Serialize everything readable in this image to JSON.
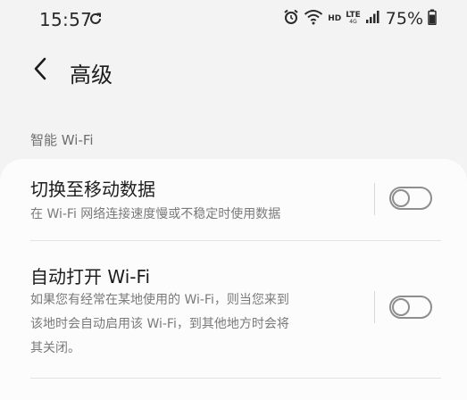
{
  "status_bar": {
    "time": "15:57",
    "hd_label": "HD",
    "lte_label": "LTE",
    "lte_sub": "4G",
    "battery_percent": "75%",
    "icons": [
      "sync-icon",
      "alarm-icon",
      "wifi-icon",
      "signal-icon",
      "battery-icon"
    ]
  },
  "header": {
    "back_icon": "chevron-left-icon",
    "title": "高级"
  },
  "section": {
    "title": "智能 Wi-Fi"
  },
  "settings": [
    {
      "title": "切换至移动数据",
      "subtitle": "在 Wi-Fi 网络连接速度慢或不稳定时使用数据",
      "enabled": false
    },
    {
      "title": "自动打开 Wi-Fi",
      "subtitle_lines": [
        "如果您有经常在某地使用的 Wi-Fi，则当您来到",
        "该地时会自动启用该 Wi-Fi，到其他地方时会将",
        "其关闭。"
      ],
      "enabled": false
    }
  ]
}
